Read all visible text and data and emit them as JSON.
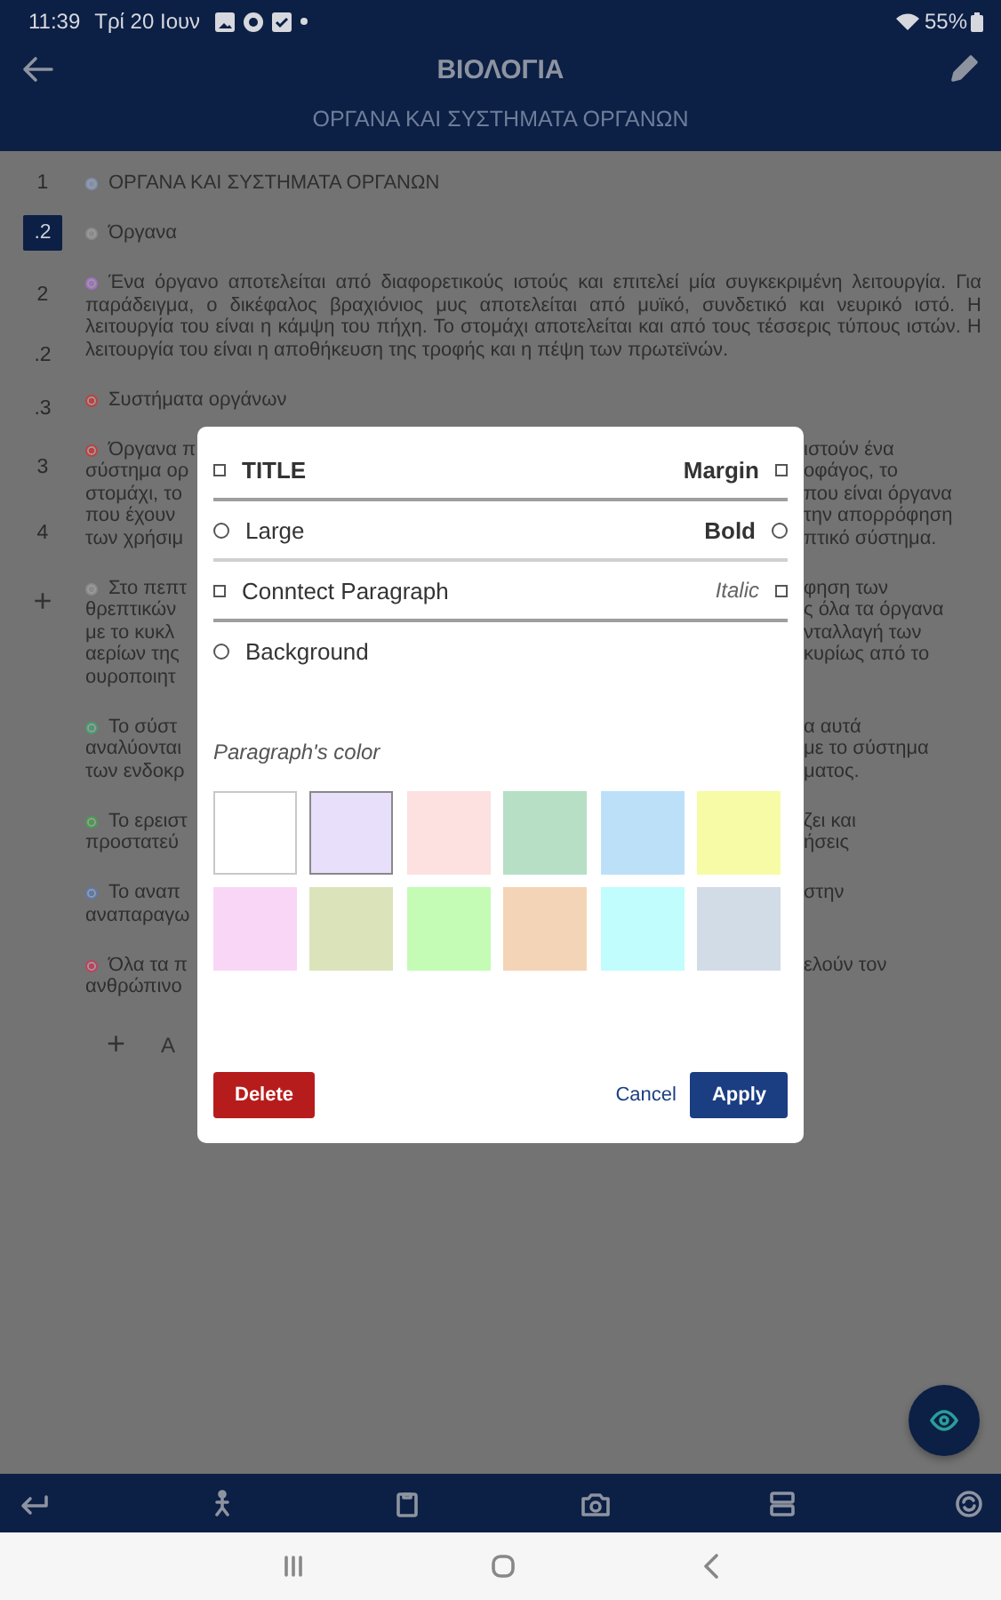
{
  "status_bar": {
    "time": "11:39",
    "date": "Τρί 20 Ιουν",
    "battery": "55%"
  },
  "header": {
    "title": "ΒΙΟΛΟΓΙΑ",
    "subtitle": "ΟΡΓΑΝΑ ΚΑΙ ΣΥΣΤΗΜΑΤΑ ΟΡΓΑΝΩΝ"
  },
  "outline_numbers": [
    {
      "label": "1",
      "selected": false
    },
    {
      "label": ".2",
      "selected": true
    },
    {
      "label": "2",
      "selected": false
    },
    {
      "label": ".2",
      "selected": false
    },
    {
      "label": ".3",
      "selected": false
    },
    {
      "label": "3",
      "selected": false
    },
    {
      "label": "4",
      "selected": false
    },
    {
      "label": "+",
      "selected": false
    }
  ],
  "paragraphs": [
    {
      "kind": "full",
      "color": "#7d8fb0",
      "text": "ΟΡΓΑΝΑ ΚΑΙ ΣΥΣΤΗΜΑΤΑ ΟΡΓΑΝΩΝ"
    },
    {
      "kind": "full",
      "color": "#8a8a8a",
      "text": "Όργανα"
    },
    {
      "kind": "full",
      "color": "#a070c0",
      "text": "Ένα όργανο αποτελείται από διαφορετικούς ιστούς και επιτελεί μία συγκεκριμένη λειτουργία. Για παράδειγμα, ο δικέφαλος βραχιόνιος μυς αποτελείται από μυϊκό, συνδετικό και νευρικό ιστό. Η λειτουργία του είναι η κάμψη του πήχη. Το στομάχι αποτελείται και από τους τέσσερις τύπους ιστών. Η λειτουργία του είναι η αποθήκευση της τροφής και η πέψη των πρωτεϊνών."
    },
    {
      "kind": "full",
      "color": "#c04040",
      "text": "Συστήματα οργάνων"
    },
    {
      "kind": "covered",
      "color": "#c04040",
      "lines": [
        {
          "left": "Όργανα π",
          "right": "ιστούν ένα"
        },
        {
          "left": "σύστημα ορ",
          "right": "οφάγος, το"
        },
        {
          "left": "στομάχι, το",
          "right": "που είναι όργανα"
        },
        {
          "left": "που έχουν",
          "right": "την απορρόφηση"
        },
        {
          "left": "των χρήσιμ",
          "right": "πτικό σύστημα."
        }
      ]
    },
    {
      "kind": "covered",
      "color": "#8a8a8a",
      "lines": [
        {
          "left": "Στο πεπτ",
          "right": "φηση των"
        },
        {
          "left": "θρεπτικών",
          "right": "ς όλα τα όργανα"
        },
        {
          "left": "με το κυκλ",
          "right": "νταλλαγή των"
        },
        {
          "left": "αερίων της",
          "right": "κυρίως από το"
        },
        {
          "left": "ουροποιητ"
        }
      ]
    },
    {
      "kind": "covered",
      "color": "#4a9a70",
      "lines": [
        {
          "left": "Το σύστ",
          "right": "α αυτά"
        },
        {
          "left": "αναλύονται",
          "right": "με το σύστημα"
        },
        {
          "left": "των ενδοκρ",
          "right": "ματος."
        }
      ]
    },
    {
      "kind": "covered",
      "color": "#4a9a50",
      "lines": [
        {
          "left": "Το ερειστ",
          "right": "ζει και"
        },
        {
          "left": "προστατεύ",
          "right": "ήσεις"
        }
      ]
    },
    {
      "kind": "covered",
      "color": "#5a7ab0",
      "lines": [
        {
          "left": "Το αναπ",
          "right": "στην"
        },
        {
          "left": "αναπαραγω"
        }
      ]
    },
    {
      "kind": "covered",
      "color": "#c04060",
      "lines": [
        {
          "left": "Όλα τα π",
          "right": "ελούν τον"
        },
        {
          "left": "ανθρώπινο"
        }
      ]
    }
  ],
  "add_row": {
    "icon": "+",
    "label": "Α"
  },
  "dialog": {
    "rows": [
      {
        "left": {
          "label": "TITLE",
          "kind": "checkbox",
          "checked": false
        },
        "right": {
          "label": "Margin",
          "kind": "checkbox",
          "checked": false
        }
      },
      {
        "left": {
          "label": "Large",
          "kind": "radio",
          "checked": false
        },
        "right": {
          "label": "Bold",
          "kind": "radio",
          "checked": false
        }
      },
      {
        "left": {
          "label": "Conntect Paragraph",
          "kind": "checkbox",
          "checked": false
        },
        "right": {
          "label": "Italic",
          "kind": "checkbox",
          "checked": false
        }
      },
      {
        "left": {
          "label": "Background",
          "kind": "radio",
          "checked": false
        }
      }
    ],
    "color_label": "Paragraph's color",
    "colors": [
      {
        "color": "#ffffff",
        "selected": false
      },
      {
        "color": "#e8e0fa",
        "selected": true
      },
      {
        "color": "#fde0e0",
        "selected": false
      },
      {
        "color": "#b7dfc5",
        "selected": false
      },
      {
        "color": "#bde0f9",
        "selected": false
      },
      {
        "color": "#f7fba6",
        "selected": false
      },
      {
        "color": "#f9d6f6",
        "selected": false
      },
      {
        "color": "#dbe3bb",
        "selected": false
      },
      {
        "color": "#c4fbb5",
        "selected": false
      },
      {
        "color": "#f4d4b6",
        "selected": false
      },
      {
        "color": "#c1fdfc",
        "selected": false
      },
      {
        "color": "#d2dce6",
        "selected": false
      }
    ],
    "delete": "Delete",
    "cancel": "Cancel",
    "apply": "Apply"
  }
}
